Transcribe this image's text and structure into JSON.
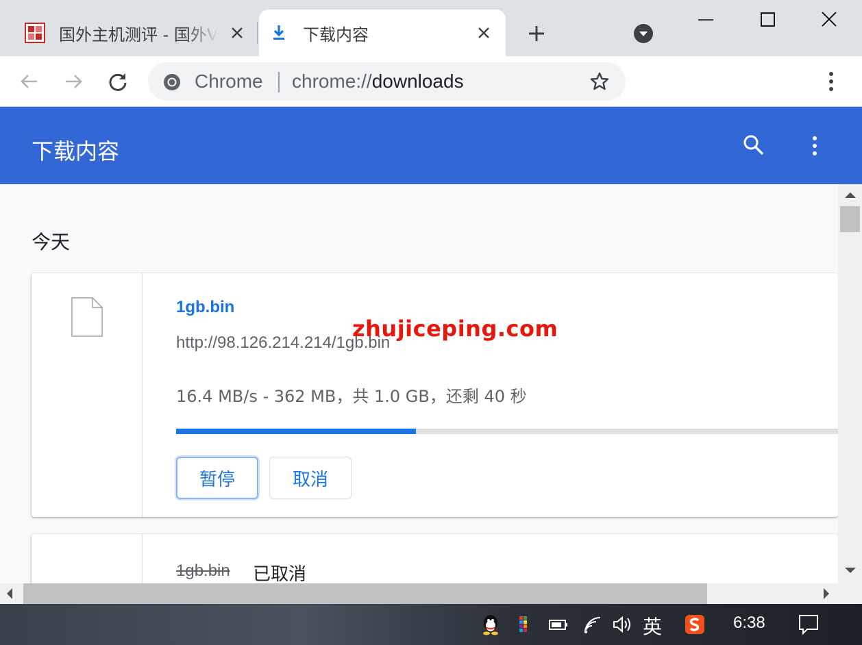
{
  "tabs": [
    {
      "title": "国外主机测评 - 国外VPS",
      "favicon": "site-logo-icon",
      "active": false
    },
    {
      "title": "下载内容",
      "favicon": "download-icon",
      "active": true
    }
  ],
  "toolbar": {
    "site_chip": "Chrome",
    "url_scheme": "chrome://",
    "url_host": "downloads"
  },
  "page": {
    "header_title": "下载内容",
    "section_date": "今天"
  },
  "downloads": [
    {
      "name": "1gb.bin",
      "url": "http://98.126.214.214/1gb.bin",
      "status": "16.4 MB/s - 362 MB，共 1.0 GB，还剩 40 秒",
      "progress": 0.362,
      "pause_label": "暂停",
      "cancel_label": "取消"
    },
    {
      "name": "1gb.bin",
      "state": "已取消"
    }
  ],
  "watermark": "zhujiceping.com",
  "taskbar": {
    "ime": "英",
    "clock": "6:38"
  },
  "colors": {
    "accent": "#3367d6",
    "link": "#1a73e8",
    "watermark": "#e8170c"
  }
}
